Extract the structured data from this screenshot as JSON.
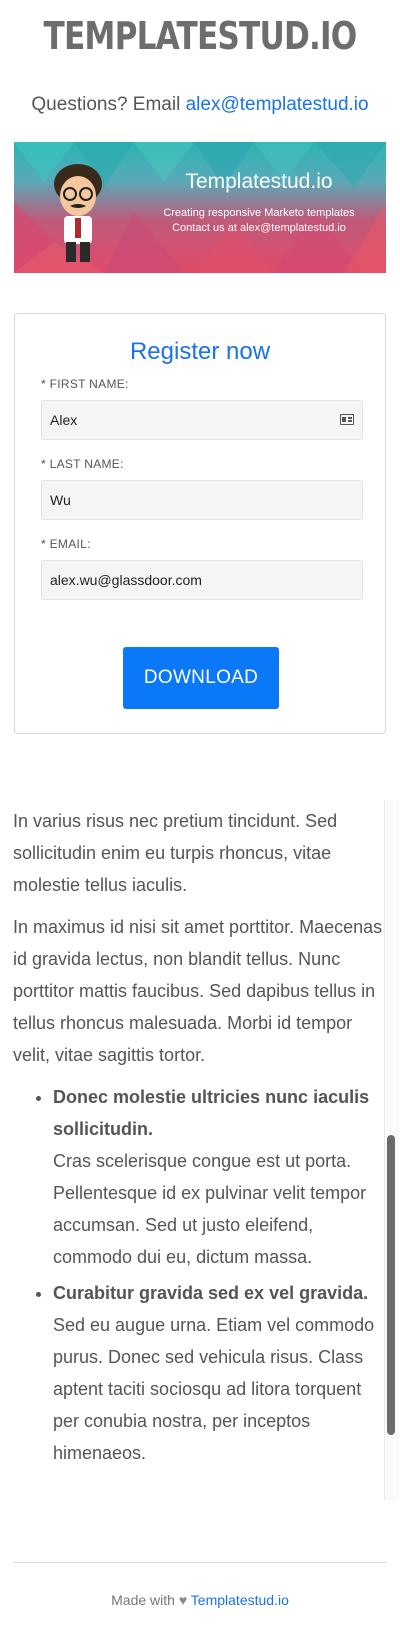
{
  "header": {
    "logo": "TEMPLATESTUD.IO",
    "questions_prefix": "Questions? Email",
    "questions_email": "alex@templatestud.io"
  },
  "banner": {
    "title": "Templatestud.io",
    "line1": "Creating responsive Marketo templates",
    "line2": "Contact us at alex@templatestud.io"
  },
  "form": {
    "title": "Register now",
    "first_name_label": "* FIRST NAME:",
    "first_name_value": "Alex",
    "last_name_label": "* LAST NAME:",
    "last_name_value": "Wu",
    "email_label": "* EMAIL:",
    "email_value": "alex.wu@glassdoor.com",
    "submit_label": "DOWNLOAD"
  },
  "content": {
    "para1": "In varius risus nec pretium tincidunt. Sed sollicitudin enim eu turpis rhoncus, vitae molestie tellus iaculis.",
    "para2": "In maximus id nisi sit amet porttitor. Maecenas id gravida lectus, non blandit tellus. Nunc porttitor mattis faucibus. Sed dapibus tellus in tellus rhoncus malesuada. Morbi id tempor velit, vitae sagittis tortor.",
    "bullets": [
      {
        "heading": "Donec molestie ultricies nunc iaculis sollicitudin.",
        "text": "Cras scelerisque congue est ut porta. Pellentesque id ex pulvinar velit tempor accumsan. Sed ut justo eleifend, commodo dui eu, dictum massa."
      },
      {
        "heading": "Curabitur gravida sed ex vel gravida.",
        "text": "Sed eu augue urna. Etiam vel commodo purus. Donec sed vehicula risus. Class aptent taciti sociosqu ad litora torquent per conubia nostra, per inceptos himenaeos."
      }
    ]
  },
  "footer": {
    "made_with": "Made with",
    "heart": "♥",
    "link": "Templatestud.io"
  }
}
